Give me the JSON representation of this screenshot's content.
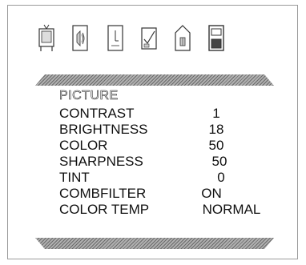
{
  "menu": {
    "title": "PICTURE",
    "icons": [
      "tv-picture-icon",
      "audio-speaker-icon",
      "clock-timer-icon",
      "setup-check-icon",
      "parental-lock-icon",
      "input-source-icon"
    ],
    "items": [
      {
        "label": "CONTRAST",
        "value": "1"
      },
      {
        "label": "BRIGHTNESS",
        "value": "18"
      },
      {
        "label": "COLOR",
        "value": "50"
      },
      {
        "label": "SHARPNESS",
        "value": "50"
      },
      {
        "label": "TINT",
        "value": "0"
      },
      {
        "label": "COMBFILTER",
        "value": "ON"
      },
      {
        "label": "COLOR TEMP",
        "value": "NORMAL"
      }
    ]
  }
}
